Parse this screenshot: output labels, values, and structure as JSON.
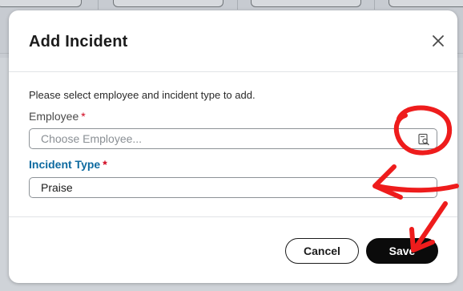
{
  "modal": {
    "title": "Add Incident",
    "instructions": "Please select employee and incident type to add.",
    "employee_label": "Employee",
    "employee_required_mark": "*",
    "employee_placeholder": "Choose Employee...",
    "incident_type_label": "Incident Type",
    "incident_type_required_mark": "*",
    "incident_type_value": "Praise",
    "cancel_label": "Cancel",
    "save_label": "Save"
  },
  "icons": {
    "close": "close-icon",
    "lookup": "lookup-search-icon"
  },
  "colors": {
    "accent_label": "#0e6aa0",
    "required": "#d0021b",
    "primary_button": "#0b0b0b",
    "annotation": "#ee1c1c"
  }
}
